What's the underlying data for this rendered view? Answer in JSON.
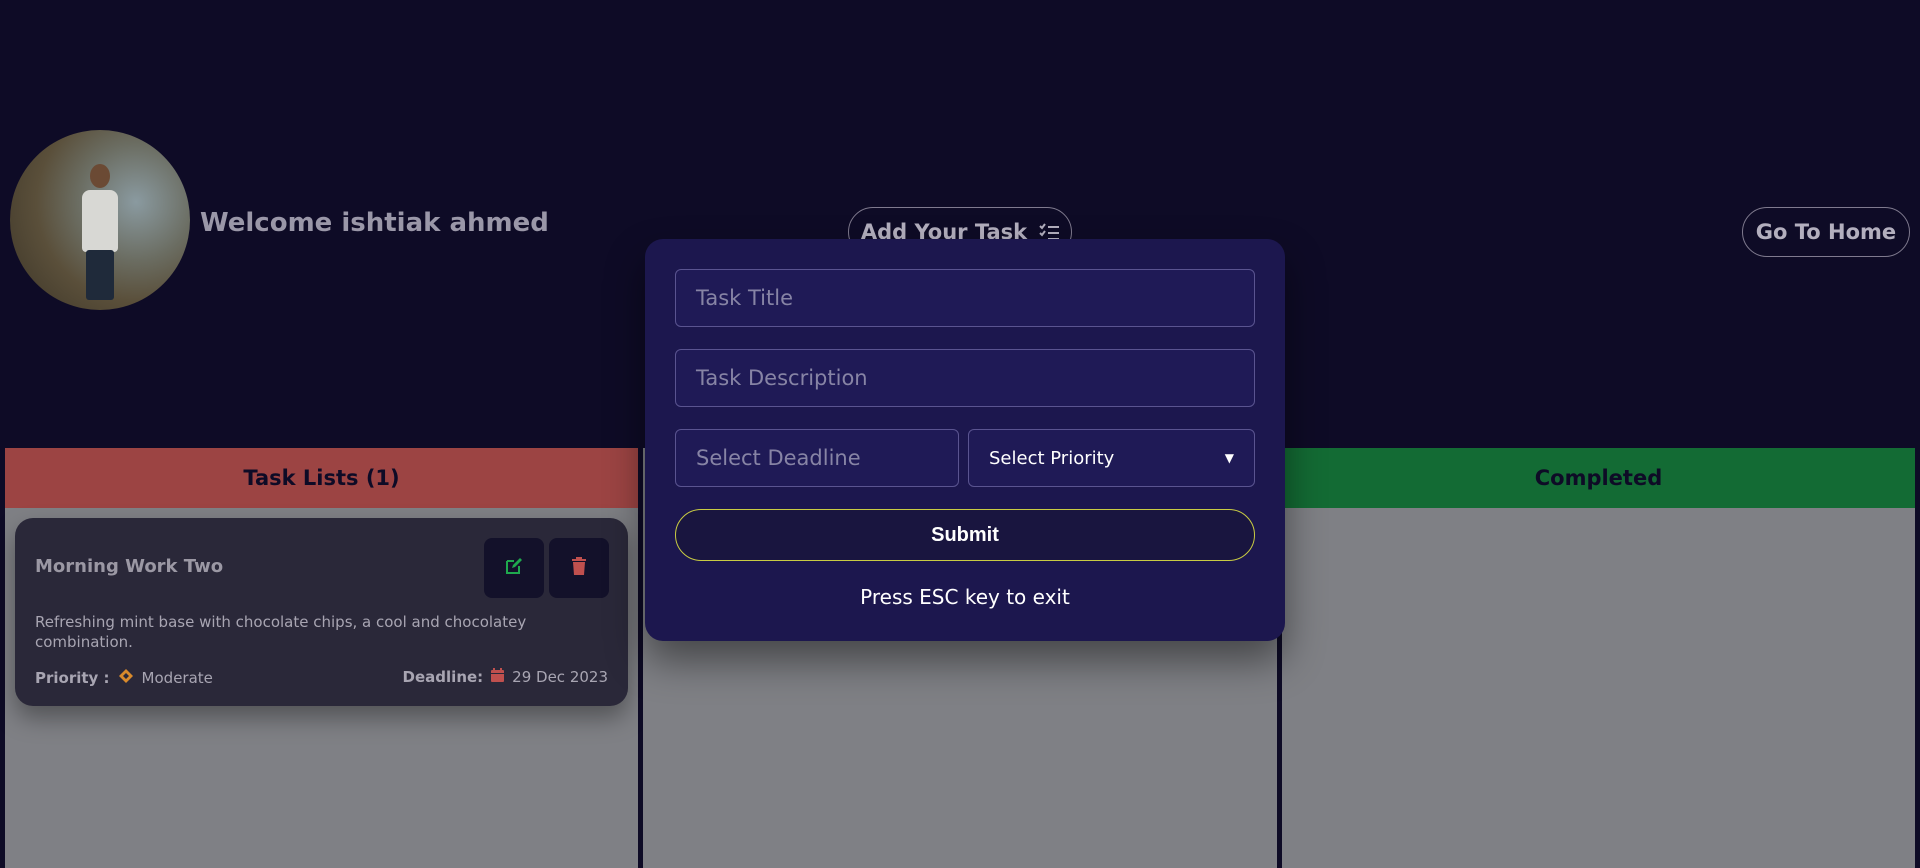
{
  "header": {
    "welcome_text": "Welcome ishtiak ahmed",
    "add_task_label": "Add Your Task",
    "home_label": "Go To Home"
  },
  "columns": [
    {
      "title": "Task Lists (1)",
      "color": "#9c4443"
    },
    {
      "title": "",
      "color": "#7f8085"
    },
    {
      "title": "Completed",
      "color": "#136b34"
    }
  ],
  "task": {
    "title": "Morning Work Two",
    "description": "Refreshing mint base with chocolate chips, a cool and chocolatey combination.",
    "priority_label": "Priority :",
    "priority_value": "Moderate",
    "deadline_label": "Deadline:",
    "deadline_value": "29 Dec 2023",
    "priority_icon": "diamond-icon",
    "deadline_icon": "calendar-icon"
  },
  "modal": {
    "title_placeholder": "Task Title",
    "description_placeholder": "Task Description",
    "deadline_placeholder": "Select Deadline",
    "priority_placeholder": "Select Priority",
    "submit_label": "Submit",
    "esc_note": "Press ESC key to exit"
  },
  "colors": {
    "background": "#0e0b26",
    "modal": "#1c174e",
    "submit_border": "#c9cc43",
    "edit_icon": "#1fa94e",
    "delete_icon": "#c0504e"
  }
}
